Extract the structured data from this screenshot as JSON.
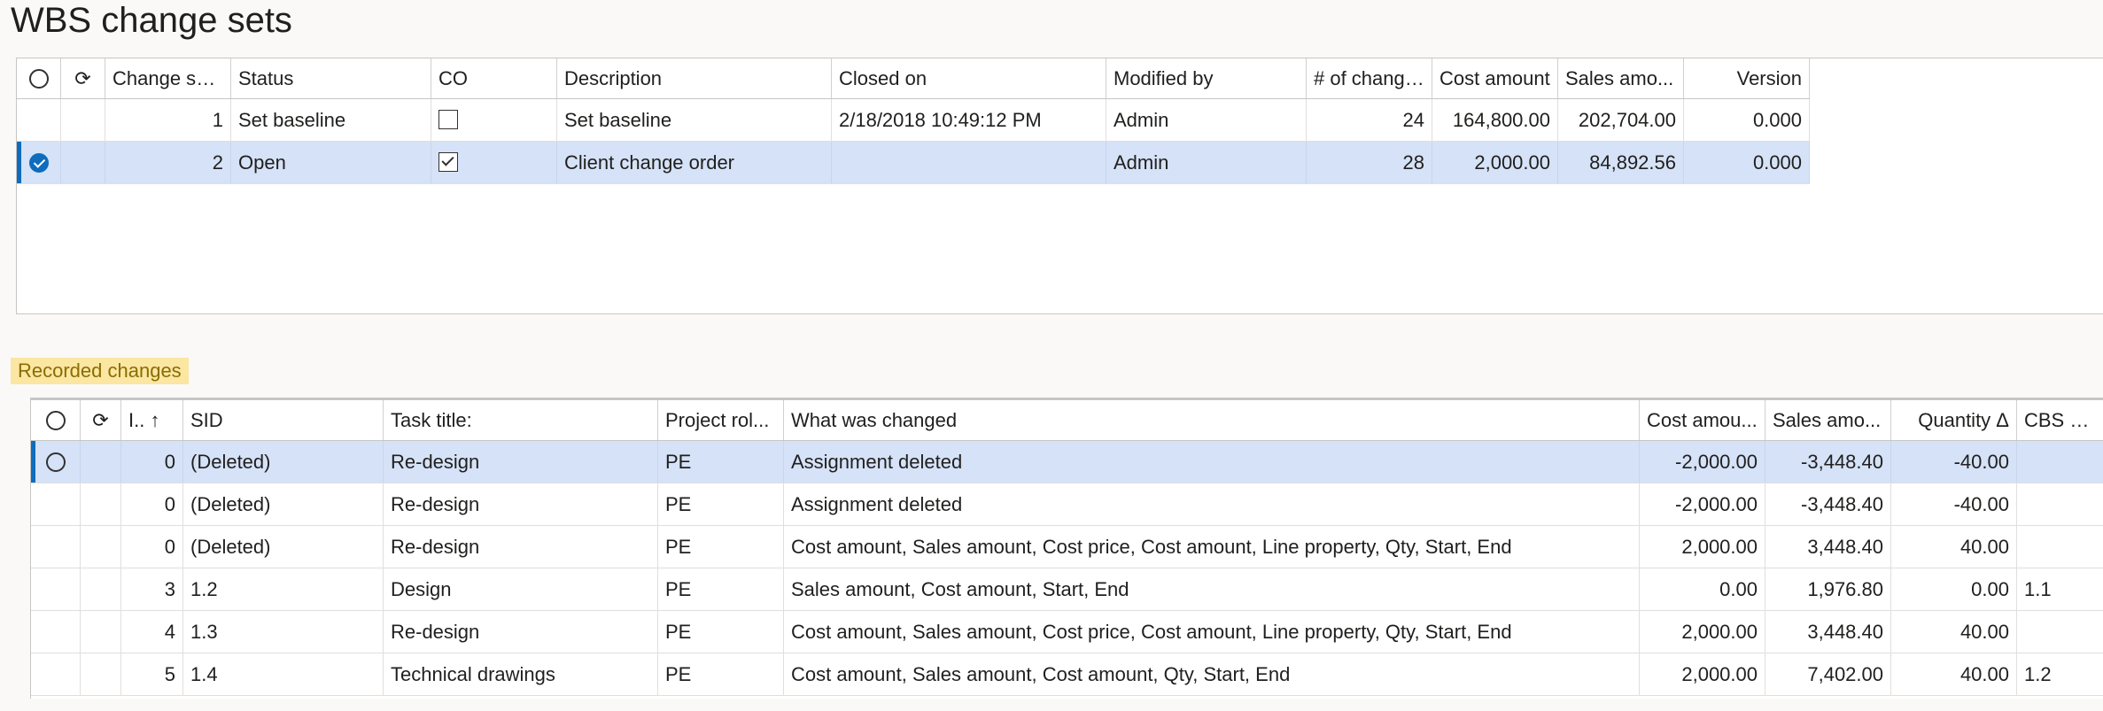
{
  "page": {
    "title": "WBS change sets"
  },
  "changesets": {
    "columns": {
      "change_set": "Change set...",
      "status": "Status",
      "co": "CO",
      "description": "Description",
      "closed_on": "Closed on",
      "modified_by": "Modified by",
      "num_changes": "# of changes",
      "cost_amount": "Cost amount",
      "sales_amount": "Sales amo...",
      "version": "Version"
    },
    "rows": [
      {
        "change_set": "1",
        "status": "Set baseline",
        "co": false,
        "description": "Set baseline",
        "closed_on": "2/18/2018 10:49:12 PM",
        "modified_by": "Admin",
        "num_changes": "24",
        "cost_amount": "164,800.00",
        "sales_amount": "202,704.00",
        "version": "0.000",
        "selected": false
      },
      {
        "change_set": "2",
        "status": "Open",
        "co": true,
        "description": "Client change order",
        "closed_on": "",
        "modified_by": "Admin",
        "num_changes": "28",
        "cost_amount": "2,000.00",
        "sales_amount": "84,892.56",
        "version": "0.000",
        "selected": true
      }
    ]
  },
  "recorded": {
    "section_label": "Recorded changes",
    "columns": {
      "id": "I..",
      "sort_icon": "↑",
      "sid": "SID",
      "task_title": "Task title:",
      "project_role": "Project rol...",
      "what_changed": "What was changed",
      "cost_amount": "Cost amou...",
      "sales_amount": "Sales amo...",
      "quantity": "Quantity Δ",
      "cbs_sid": "CBS SID"
    },
    "rows": [
      {
        "id": "0",
        "sid": "(Deleted)",
        "task_title": "Re-design",
        "project_role": "PE",
        "what_changed": "Assignment deleted",
        "cost_amount": "-2,000.00",
        "sales_amount": "-3,448.40",
        "quantity": "-40.00",
        "cbs_sid": "",
        "selected": true
      },
      {
        "id": "0",
        "sid": "(Deleted)",
        "task_title": "Re-design",
        "project_role": "PE",
        "what_changed": "Assignment deleted",
        "cost_amount": "-2,000.00",
        "sales_amount": "-3,448.40",
        "quantity": "-40.00",
        "cbs_sid": "",
        "selected": false
      },
      {
        "id": "0",
        "sid": "(Deleted)",
        "task_title": "Re-design",
        "project_role": "PE",
        "what_changed": "Cost amount, Sales amount, Cost price, Cost amount, Line property, Qty, Start, End",
        "cost_amount": "2,000.00",
        "sales_amount": "3,448.40",
        "quantity": "40.00",
        "cbs_sid": "",
        "selected": false
      },
      {
        "id": "3",
        "sid": "1.2",
        "task_title": "Design",
        "project_role": "PE",
        "what_changed": "Sales amount, Cost amount, Start, End",
        "cost_amount": "0.00",
        "sales_amount": "1,976.80",
        "quantity": "0.00",
        "cbs_sid": "1.1",
        "selected": false
      },
      {
        "id": "4",
        "sid": "1.3",
        "task_title": "Re-design",
        "project_role": "PE",
        "what_changed": "Cost amount, Sales amount, Cost price, Cost amount, Line property, Qty, Start, End",
        "cost_amount": "2,000.00",
        "sales_amount": "3,448.40",
        "quantity": "40.00",
        "cbs_sid": "",
        "selected": false
      },
      {
        "id": "5",
        "sid": "1.4",
        "task_title": "Technical drawings",
        "project_role": "PE",
        "what_changed": "Cost amount, Sales amount, Cost amount, Qty, Start, End",
        "cost_amount": "2,000.00",
        "sales_amount": "7,402.00",
        "quantity": "40.00",
        "cbs_sid": "1.2",
        "selected": false
      }
    ]
  },
  "icons": {
    "select_all": "radio-circle-icon",
    "refresh": "refresh-icon",
    "checkbox": "checkbox-icon",
    "sort": "sort-ascending-icon"
  },
  "colors": {
    "accent": "#0f6cbd",
    "selected_row": "#d5e2f7",
    "highlight": "#fbe6a2"
  }
}
